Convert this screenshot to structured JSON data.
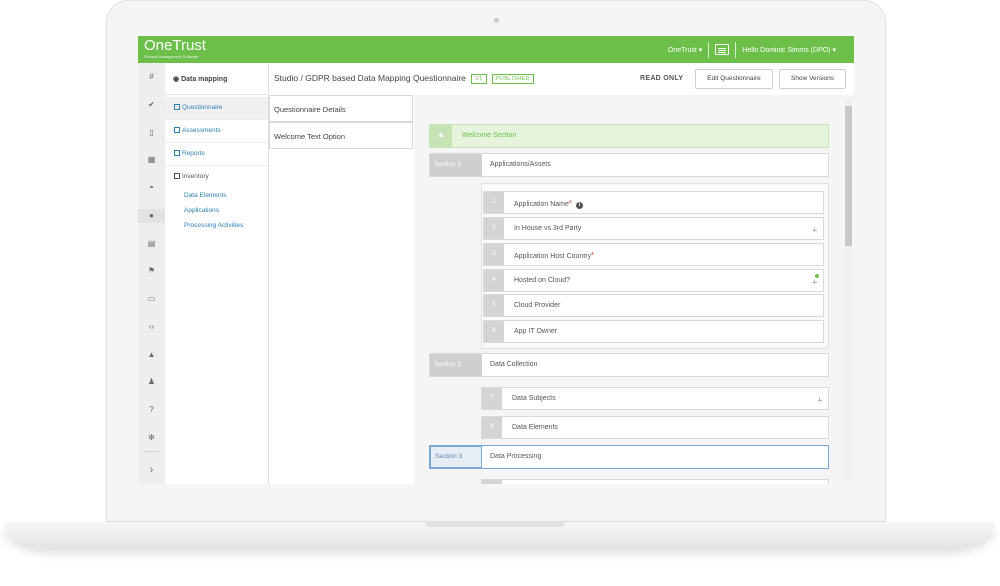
{
  "app": {
    "logo": "OneTrust",
    "logo_sub": "Privacy Management Software",
    "org_menu": "OneTrust ▾",
    "user_menu": "Hello Dominic Simms (DPO) ▾",
    "brand_color": "#6cc04a"
  },
  "rail": {
    "icons": [
      "home-icon",
      "check-icon",
      "document-icon",
      "grid-icon",
      "dashboard-icon",
      "globe-icon",
      "table-icon",
      "flag-icon",
      "folder-icon",
      "code-icon",
      "user-icon",
      "users-icon",
      "help-icon",
      "settings-icon",
      "expand-icon"
    ],
    "expand_label": "›"
  },
  "nav": {
    "header": "Data mapping",
    "items": [
      {
        "label": "Questionnaire",
        "active": true
      },
      {
        "label": "Assessments"
      },
      {
        "label": "Reports"
      },
      {
        "label": "Inventory"
      }
    ],
    "inventory_sub": [
      "Data Elements",
      "Applications",
      "Processing Activities"
    ]
  },
  "header": {
    "breadcrumb_root": "Studio",
    "separator": "/",
    "title": "GDPR based Data Mapping Questionnaire",
    "version": "V1",
    "status": "PUBLISHED",
    "mode": "READ ONLY",
    "edit_button": "Edit Questionnaire",
    "versions_button": "Show Versions"
  },
  "tabs": [
    "Questionnaire Details",
    "Welcome Text Option"
  ],
  "builder": {
    "welcome": "Welcome Section",
    "sections": [
      {
        "label": "Section 1",
        "title": "Applications/Assets"
      },
      {
        "label": "Section 2",
        "title": "Data Collection"
      },
      {
        "label": "Section 3",
        "title": "Data Processing"
      }
    ],
    "questions": [
      {
        "num": "1",
        "text": "Application Name"
      },
      {
        "num": "2",
        "text": "In House vs 3rd Party"
      },
      {
        "num": "3",
        "text": "Application Host Country"
      },
      {
        "num": "4",
        "text": "Hosted on Cloud?"
      },
      {
        "num": "5",
        "text": "Cloud Provider"
      },
      {
        "num": "6",
        "text": "App IT Owner"
      },
      {
        "num": "7",
        "text": "Data Subjects"
      },
      {
        "num": "8",
        "text": "Data Elements"
      }
    ]
  }
}
